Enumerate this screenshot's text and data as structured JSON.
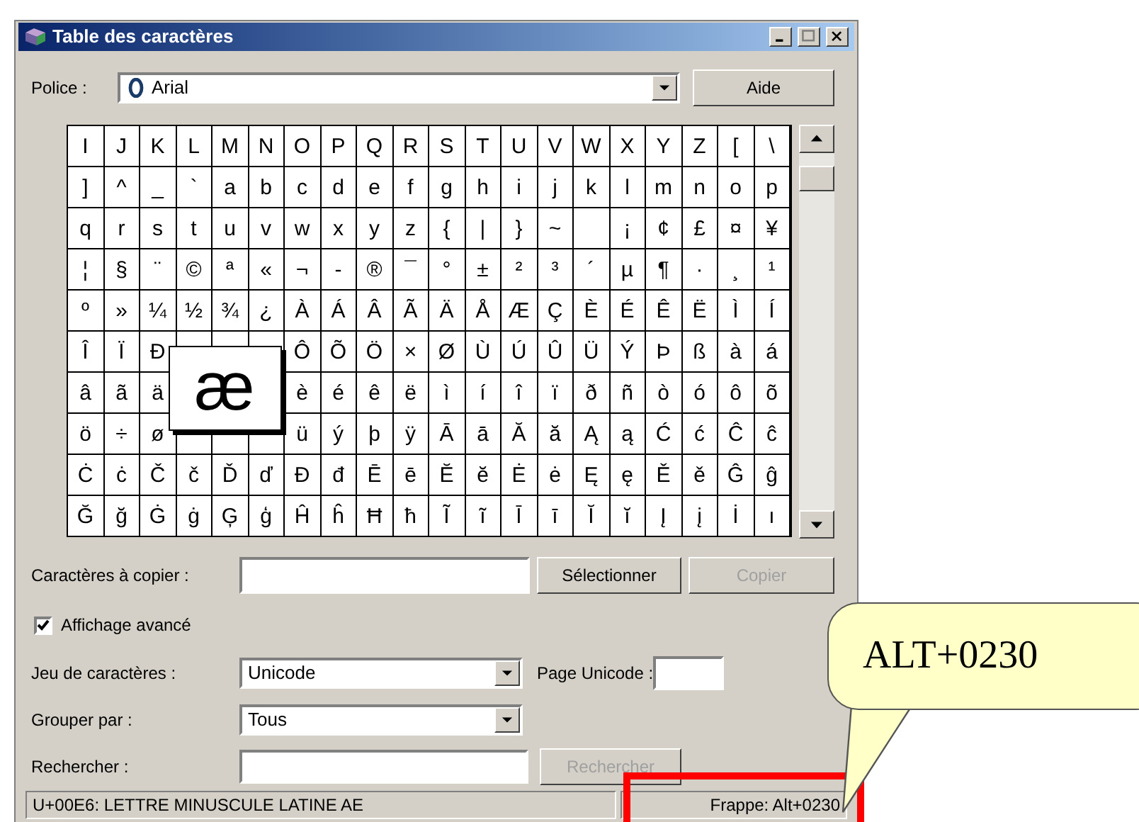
{
  "window": {
    "title": "Table des caractères"
  },
  "font_row": {
    "label": "Police :",
    "value": "Arial",
    "help_button": "Aide"
  },
  "grid": [
    [
      "I",
      "J",
      "K",
      "L",
      "M",
      "N",
      "O",
      "P",
      "Q",
      "R",
      "S",
      "T",
      "U",
      "V",
      "W",
      "X",
      "Y",
      "Z",
      "[",
      "\\"
    ],
    [
      "]",
      "^",
      "_",
      "`",
      "a",
      "b",
      "c",
      "d",
      "e",
      "f",
      "g",
      "h",
      "i",
      "j",
      "k",
      "l",
      "m",
      "n",
      "o",
      "p"
    ],
    [
      "q",
      "r",
      "s",
      "t",
      "u",
      "v",
      "w",
      "x",
      "y",
      "z",
      "{",
      "|",
      "}",
      "~",
      {
        "kind": "empty"
      },
      "¡",
      "¢",
      "£",
      "¤",
      "¥"
    ],
    [
      "¦",
      "§",
      "¨",
      "©",
      "ª",
      "«",
      "¬",
      "-",
      "®",
      "¯",
      "°",
      "±",
      "²",
      "³",
      "´",
      "µ",
      "¶",
      "·",
      "¸",
      "¹"
    ],
    [
      "º",
      "»",
      "¼",
      "½",
      "¾",
      "¿",
      "À",
      "Á",
      "Â",
      "Ã",
      "Ä",
      "Å",
      "Æ",
      "Ç",
      "È",
      "É",
      "Ê",
      "Ë",
      "Ì",
      "Í"
    ],
    [
      "Î",
      "Ï",
      "Ð",
      {
        "kind": "empty"
      },
      {
        "kind": "empty"
      },
      {
        "kind": "empty"
      },
      "Ô",
      "Õ",
      "Ö",
      "×",
      "Ø",
      "Ù",
      "Ú",
      "Û",
      "Ü",
      "Ý",
      "Þ",
      "ß",
      "à",
      "á"
    ],
    [
      "â",
      "ã",
      "ä",
      {
        "kind": "magnifier",
        "char": "æ"
      },
      "è",
      "é",
      "ê",
      "ë",
      "ì",
      "í",
      "î",
      "ï",
      "ð",
      "ñ",
      "ò",
      "ó",
      "ô",
      "õ"
    ],
    [
      "ö",
      "÷",
      "ø",
      {
        "kind": "empty"
      },
      {
        "kind": "empty"
      },
      {
        "kind": "empty"
      },
      "ü",
      "ý",
      "þ",
      "ÿ",
      "Ā",
      "ā",
      "Ă",
      "ă",
      "Ą",
      "ą",
      "Ć",
      "ć",
      "Ĉ",
      "ĉ"
    ],
    [
      "Ċ",
      "ċ",
      "Č",
      "č",
      "Ď",
      "ď",
      "Đ",
      "đ",
      "Ē",
      "ē",
      "Ĕ",
      "ĕ",
      "Ė",
      "ė",
      "Ę",
      "ę",
      "Ě",
      "ě",
      "Ĝ",
      "ĝ"
    ],
    [
      "Ğ",
      "ğ",
      "Ġ",
      "ġ",
      "Ģ",
      "ģ",
      "Ĥ",
      "ĥ",
      "Ħ",
      "ħ",
      "Ĩ",
      "ĩ",
      "Ī",
      "ī",
      "Ĭ",
      "ĭ",
      "Į",
      "į",
      "İ",
      "ı"
    ]
  ],
  "copy_row": {
    "label": "Caractères à copier :",
    "select_button": "Sélectionner",
    "copy_button": {
      "label": "Copier",
      "disabled": true
    }
  },
  "advanced_view": {
    "label": "Affichage avancé",
    "checked": true
  },
  "charset_row": {
    "label": "Jeu de caractères :",
    "value": "Unicode",
    "page_label": "Page Unicode :"
  },
  "group_row": {
    "label": "Grouper par :",
    "value": "Tous"
  },
  "search_row": {
    "label": "Rechercher :",
    "button": {
      "label": "Rechercher",
      "disabled": true
    }
  },
  "status_bar": {
    "description": "U+00E6: LETTRE MINUSCULE LATINE AE",
    "keystroke": "Frappe: Alt+0230"
  },
  "callout": {
    "text": "ALT+0230"
  }
}
